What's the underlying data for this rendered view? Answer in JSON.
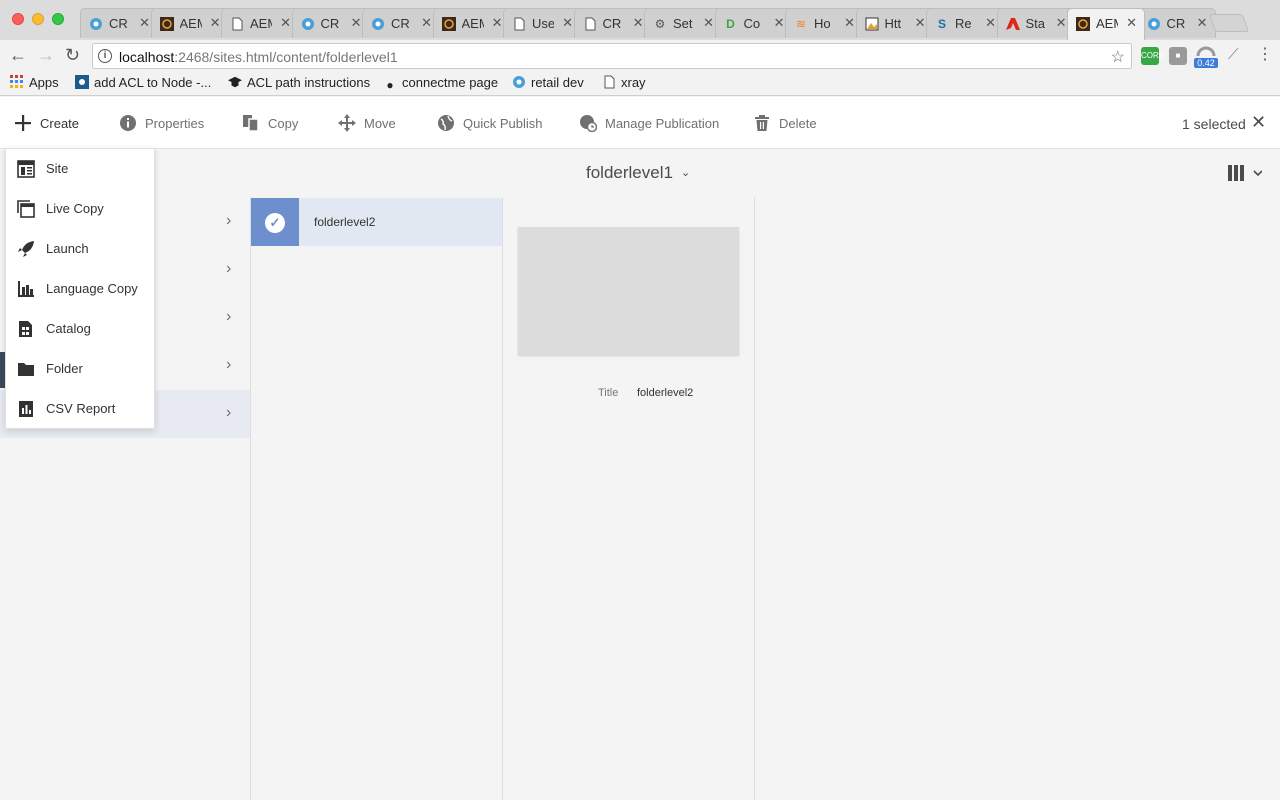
{
  "browser": {
    "tabs": [
      {
        "title": "CR",
        "icon": "crx-icon",
        "active": false
      },
      {
        "title": "AEM",
        "icon": "aem-icon",
        "active": false
      },
      {
        "title": "AEM",
        "icon": "page-icon",
        "active": false
      },
      {
        "title": "CR",
        "icon": "crx-icon",
        "active": false
      },
      {
        "title": "CR",
        "icon": "crx-icon",
        "active": false
      },
      {
        "title": "AEM",
        "icon": "aem-icon",
        "active": false
      },
      {
        "title": "Use",
        "icon": "page-icon",
        "active": false
      },
      {
        "title": "CR",
        "icon": "page-icon",
        "active": false
      },
      {
        "title": "Set",
        "icon": "gear-icon",
        "active": false
      },
      {
        "title": "Co",
        "icon": "d-icon",
        "active": false
      },
      {
        "title": "Ho",
        "icon": "stackoverflow-icon",
        "active": false
      },
      {
        "title": "Htt",
        "icon": "image-icon",
        "active": false
      },
      {
        "title": "Re",
        "icon": "s-icon",
        "active": false
      },
      {
        "title": "Sta",
        "icon": "adobe-icon",
        "active": false
      },
      {
        "title": "AEM",
        "icon": "aem-icon",
        "active": true
      },
      {
        "title": "CR",
        "icon": "crx-icon",
        "active": false
      }
    ],
    "url_host": "localhost",
    "url_rest": ":2468/sites.html/content/folderlevel1",
    "extension_badge": "0.42",
    "bookmarks": [
      {
        "label": "Apps",
        "icon": "apps-grid-icon"
      },
      {
        "label": "add ACL to Node -...",
        "icon": "aem-icon"
      },
      {
        "label": "ACL path instructions",
        "icon": "graduation-cap-icon"
      },
      {
        "label": "connectme page",
        "icon": "apple-icon"
      },
      {
        "label": "retail dev",
        "icon": "crx-icon"
      },
      {
        "label": "xray",
        "icon": "page-icon"
      }
    ]
  },
  "actionbar": {
    "create": "Create",
    "properties": "Properties",
    "copy": "Copy",
    "move": "Move",
    "quick_publish": "Quick Publish",
    "manage_publication": "Manage Publication",
    "delete": "Delete",
    "selected": "1 selected"
  },
  "create_menu": [
    {
      "label": "Site",
      "icon": "site-icon"
    },
    {
      "label": "Live Copy",
      "icon": "live-copy-icon"
    },
    {
      "label": "Launch",
      "icon": "launch-icon"
    },
    {
      "label": "Language Copy",
      "icon": "language-copy-icon"
    },
    {
      "label": "Catalog",
      "icon": "catalog-icon"
    },
    {
      "label": "Folder",
      "icon": "folder-icon"
    },
    {
      "label": "CSV Report",
      "icon": "csv-report-icon"
    }
  ],
  "header": {
    "folder": "folderlevel1"
  },
  "columns": {
    "selected_item": "folderlevel2",
    "detail": {
      "title_label": "Title",
      "title_value": "folderlevel2"
    }
  },
  "colors": {
    "selection": "#6e8fce",
    "selected_row": "#e2e8f1"
  }
}
